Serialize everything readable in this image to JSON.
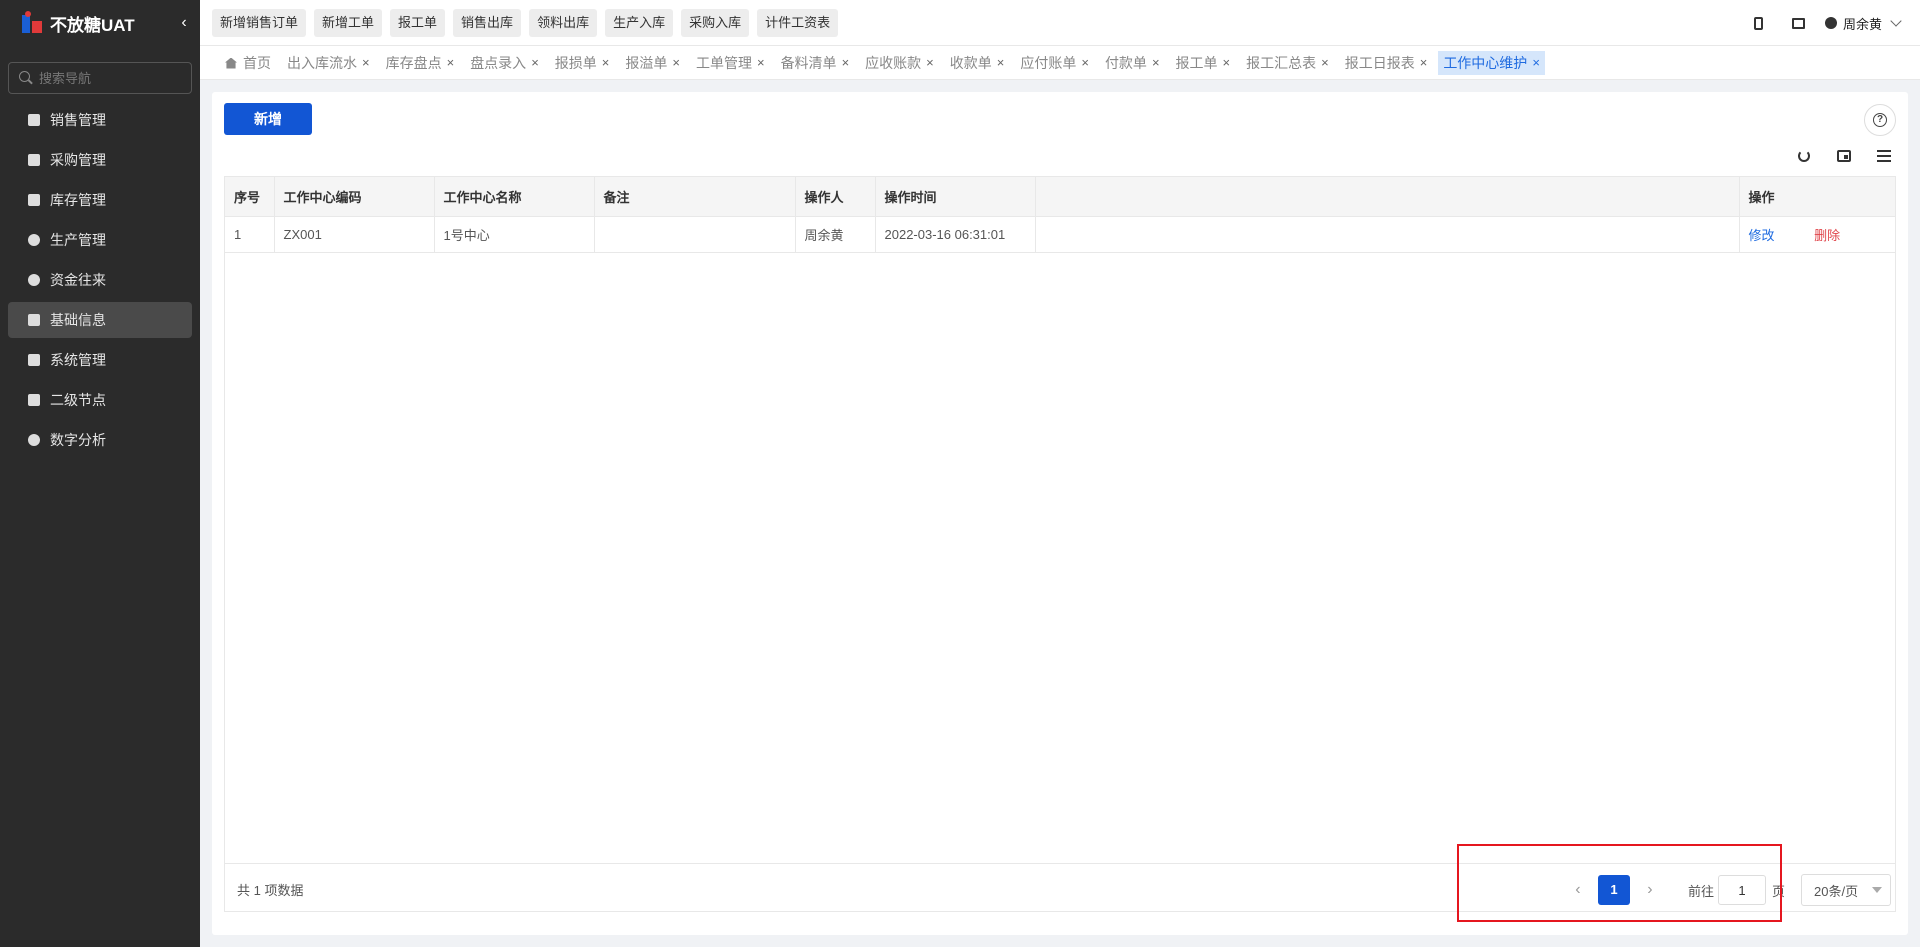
{
  "app": {
    "title": "不放糖UAT"
  },
  "sidebar": {
    "collapse_symbol": "‹",
    "search_placeholder": "搜索导航",
    "items": [
      {
        "label": "销售管理",
        "icon": "tag-icon"
      },
      {
        "label": "采购管理",
        "icon": "cart-icon"
      },
      {
        "label": "库存管理",
        "icon": "box-icon"
      },
      {
        "label": "生产管理",
        "icon": "factory-icon"
      },
      {
        "label": "资金往来",
        "icon": "money-icon"
      },
      {
        "label": "基础信息",
        "icon": "layout-icon",
        "active": true
      },
      {
        "label": "系统管理",
        "icon": "grid-icon"
      },
      {
        "label": "二级节点",
        "icon": "document-icon"
      },
      {
        "label": "数字分析",
        "icon": "pie-chart-icon"
      }
    ]
  },
  "toolbar": {
    "quick_buttons": [
      "新增销售订单",
      "新增工单",
      "报工单",
      "销售出库",
      "领料出库",
      "生产入库",
      "采购入库",
      "计件工资表"
    ],
    "user_name": "周余黄"
  },
  "tabs": {
    "items": [
      {
        "label": "首页",
        "closable": false
      },
      {
        "label": "出入库流水",
        "closable": true
      },
      {
        "label": "库存盘点",
        "closable": true
      },
      {
        "label": "盘点录入",
        "closable": true
      },
      {
        "label": "报损单",
        "closable": true
      },
      {
        "label": "报溢单",
        "closable": true
      },
      {
        "label": "工单管理",
        "closable": true
      },
      {
        "label": "备料清单",
        "closable": true
      },
      {
        "label": "应收账款",
        "closable": true
      },
      {
        "label": "收款单",
        "closable": true
      },
      {
        "label": "应付账单",
        "closable": true
      },
      {
        "label": "付款单",
        "closable": true
      },
      {
        "label": "报工单",
        "closable": true
      },
      {
        "label": "报工汇总表",
        "closable": true
      },
      {
        "label": "报工日报表",
        "closable": true
      },
      {
        "label": "工作中心维护",
        "closable": true,
        "active": true
      }
    ],
    "close_symbol": "×"
  },
  "main": {
    "add_button": "新增",
    "help_symbol": "?",
    "table": {
      "columns": [
        "序号",
        "工作中心编码",
        "工作中心名称",
        "备注",
        "操作人",
        "操作时间",
        "",
        "操作"
      ],
      "rows": [
        {
          "index": "1",
          "code": "ZX001",
          "name": "1号中心",
          "remark": "",
          "operator": "周余黄",
          "time": "2022-03-16 06:31:01",
          "edit": "修改",
          "delete": "删除"
        }
      ]
    },
    "pagination": {
      "total_text": "共 1 项数据",
      "prev_symbol": "‹",
      "next_symbol": "›",
      "current_page": "1",
      "goto_label": "前往",
      "goto_value": "1",
      "page_suffix": "页",
      "page_size": "20条/页"
    }
  },
  "colors": {
    "primary": "#1256d4",
    "sidebar_bg": "#2b2b2b",
    "danger": "#e0444a",
    "highlight_border": "#e5161f"
  }
}
